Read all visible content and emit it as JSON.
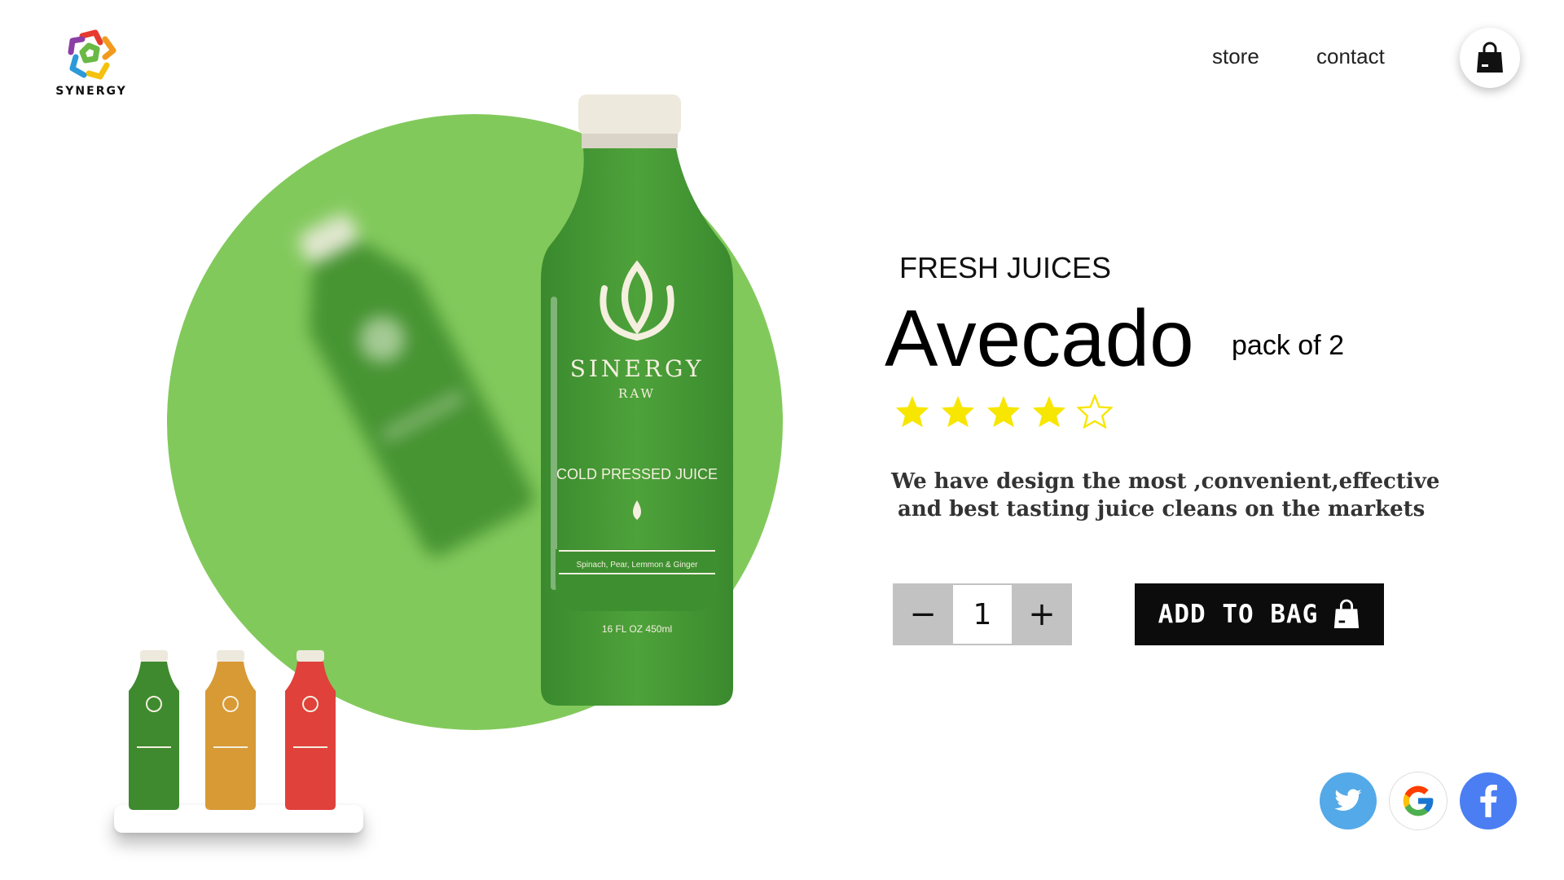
{
  "brand": {
    "logo_text": "SYNERGY"
  },
  "nav": {
    "store": "store",
    "contact": "contact"
  },
  "icons": {
    "cart": "shopping-bag-icon",
    "social": [
      "twitter-icon",
      "google-icon",
      "facebook-icon"
    ]
  },
  "bottle": {
    "brand": "SINERGY",
    "sub": "RAW",
    "label": "COLD PRESSED JUICE",
    "ingredients": "Spinach, Pear, Lemmon & Ginger",
    "volume": "16 FL OZ 450ml"
  },
  "thumbnails": [
    {
      "color": "#3f8a2f"
    },
    {
      "color": "#d89a35"
    },
    {
      "color": "#e0413b"
    }
  ],
  "product": {
    "category": "FRESH JUICES",
    "name": "Avecado",
    "pack": "pack of 2",
    "rating": 4,
    "rating_max": 5,
    "description_line1": "We have design the most ,convenient,effective",
    "description_line2": "and best tasting juice cleans on the markets"
  },
  "quantity": {
    "minus": "−",
    "value": "1",
    "plus": "+"
  },
  "cta": {
    "add_to_bag": "ADD TO BAG"
  },
  "colors": {
    "accent_green": "#82c95c",
    "star_yellow": "#f7e600",
    "button_dark": "#0c0c0c"
  }
}
